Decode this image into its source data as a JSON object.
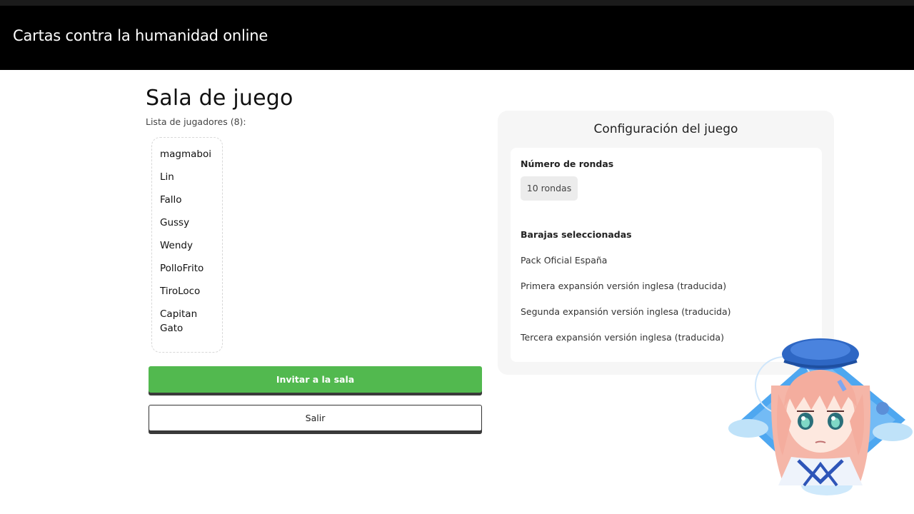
{
  "header": {
    "title": "Cartas contra la humanidad online"
  },
  "room": {
    "title": "Sala de juego",
    "players_label": "Lista de jugadores (8):",
    "players": [
      "magmaboi",
      "Lin",
      "Fallo",
      "Gussy",
      "Wendy",
      "PolloFrito",
      "TiroLoco",
      "Capitan Gato"
    ],
    "invite_label": "Invitar a la sala",
    "exit_label": "Salir"
  },
  "config": {
    "title": "Configuración del juego",
    "rounds_label": "Número de rondas",
    "rounds_value": "10 rondas",
    "decks_label": "Barajas seleccionadas",
    "decks": [
      "Pack Oficial España",
      "Primera expansión versión inglesa (traducida)",
      "Segunda expansión versión inglesa (traducida)",
      "Tercera expansión versión inglesa (traducida)"
    ]
  },
  "colors": {
    "header_bg": "#000000",
    "invite_button": "#52b94f",
    "panel_bg": "#f6f6f6"
  },
  "icons": {
    "avatar": "anime-girl-avatar"
  }
}
